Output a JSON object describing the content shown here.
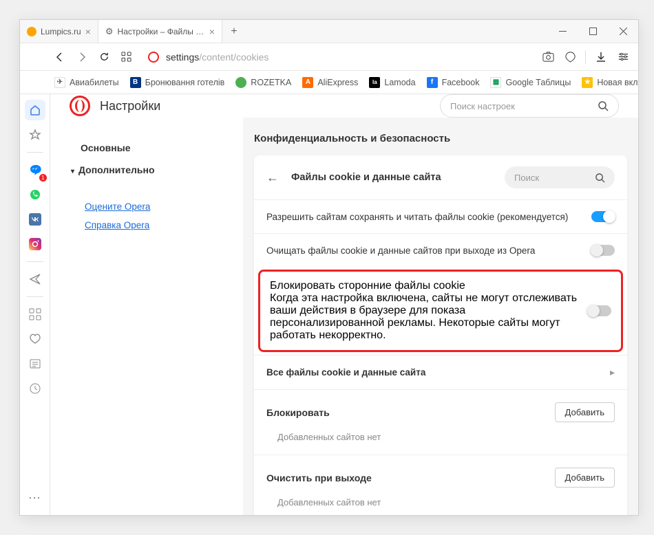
{
  "tabs": [
    {
      "title": "Lumpics.ru",
      "favicon": "lumpics"
    },
    {
      "title": "Настройки – Файлы cookie",
      "favicon": "gear",
      "active": true
    }
  ],
  "url": {
    "host": "settings",
    "path": "/content/cookies"
  },
  "bookmarks": [
    {
      "label": "Авиабилеты",
      "color": "#fff",
      "fg": "#666",
      "letter": "✈"
    },
    {
      "label": "Бронювання готелів",
      "color": "#003580",
      "letter": "B"
    },
    {
      "label": "ROZETKA",
      "color": "#4caf50",
      "letter": "●"
    },
    {
      "label": "AliExpress",
      "color": "#ff6a00",
      "letter": "A"
    },
    {
      "label": "Lamoda",
      "color": "#000",
      "letter": "la"
    },
    {
      "label": "Facebook",
      "color": "#1877f2",
      "letter": "f"
    },
    {
      "label": "Google Таблицы",
      "color": "#fff",
      "letter": "▦",
      "fg": "#0f9d58"
    },
    {
      "label": "Новая вкладка",
      "color": "#ffc107",
      "letter": "★"
    }
  ],
  "settings": {
    "title": "Настройки",
    "search_placeholder": "Поиск настроек",
    "nav": {
      "basic": "Основные",
      "advanced": "Дополнительно",
      "rate": "Оцените Opera",
      "help": "Справка Opera"
    },
    "section_heading": "Конфиденциальность и безопасность",
    "card": {
      "title": "Файлы cookie и данные сайта",
      "search_placeholder": "Поиск",
      "allow": "Разрешить сайтам сохранять и читать файлы cookie (рекомендуется)",
      "clear_on_exit": "Очищать файлы cookie и данные сайтов при выходе из Opera",
      "block_third_title": "Блокировать сторонние файлы cookie",
      "block_third_sub": "Когда эта настройка включена, сайты не могут отслеживать ваши действия в браузере для показа персонализированной рекламы. Некоторые сайты могут работать некорректно.",
      "all_cookies": "Все файлы cookie и данные сайта",
      "block_section": "Блокировать",
      "clear_exit_section": "Очистить при выходе",
      "add_button": "Добавить",
      "no_sites": "Добавленных сайтов нет"
    }
  }
}
